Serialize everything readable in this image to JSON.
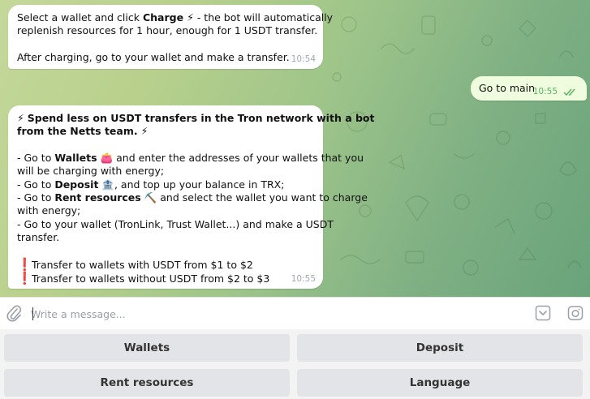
{
  "messages": [
    {
      "id": "bot-1",
      "sender": "bot",
      "lines": {
        "l1_pre": "Select a wallet and click ",
        "l1_bold": "Charge",
        "l1_emoji": "⚡",
        "l1_post": " - the bot will automatically",
        "l2": "replenish resources for 1 hour, enough for 1 USDT transfer.",
        "l3": "After charging, go to your wallet and make a transfer."
      },
      "time": "10:54"
    },
    {
      "id": "user-1",
      "sender": "user",
      "text": "Go to main",
      "time": "10:55",
      "status_icon": "double-check-icon"
    },
    {
      "id": "bot-2",
      "sender": "bot",
      "lines": {
        "h1_emoji": "⚡",
        "h1": "Spend less on USDT transfers in the Tron network with a bot",
        "h2": "from the Netts team.",
        "h2_emoji": "⚡",
        "w_pre": "- Go to ",
        "w_bold": "Wallets",
        "w_emoji": "👛",
        "w_post": " and enter the addresses of your wallets that you",
        "w2": "will be charging with energy;",
        "d_pre": "- Go to ",
        "d_bold": "Deposit",
        "d_emoji": "🏦",
        "d_post": ", and top up your balance in TRX;",
        "r_pre": "- Go to ",
        "r_bold": "Rent resources",
        "r_emoji": "⛏️",
        "r_post": " and select the wallet you want to charge",
        "r2": "with energy;",
        "t1": "- Go to your wallet (TronLink, Trust Wallet...) and make a USDT",
        "t2": "transfer.",
        "alert_emoji": "❗",
        "n1": "Transfer to wallets with USDT from $1 to $2",
        "n2": "Transfer to wallets without USDT from $2 to $3"
      },
      "time": "10:55"
    }
  ],
  "composer": {
    "placeholder": "Write a message...",
    "left_icon": "paperclip-icon",
    "right_icons": [
      "bot-keyboard-icon",
      "camera-icon"
    ]
  },
  "keyboard": {
    "buttons": [
      "Wallets",
      "Deposit",
      "Rent resources",
      "Language"
    ]
  },
  "colors": {
    "incoming_bubble": "#ffffff",
    "outgoing_bubble": "#effdde",
    "outgoing_time": "#5eb166",
    "alert": "#d71a1a",
    "keyboard_button": "#e2e4e7"
  }
}
